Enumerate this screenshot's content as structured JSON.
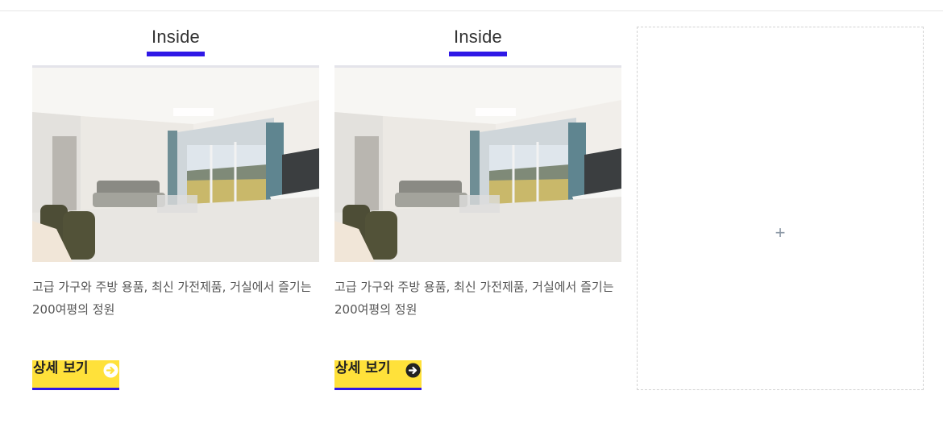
{
  "cards": [
    {
      "title": "Inside",
      "image_alt": "living room photo",
      "description": "고급 가구와 주방 용품,  최신 가전제품, 거실에서 즐기는 200여평의 정원",
      "detail_label": "상세 보기",
      "icon": "arrow-right-circle-icon",
      "icon_style": "light"
    },
    {
      "title": "Inside",
      "image_alt": "living room photo",
      "description": "고급 가구와 주방 용품,  최신 가전제품, 거실에서 즐기는 200여평의 정원",
      "detail_label": "상세 보기",
      "icon": "arrow-right-circle-icon",
      "icon_style": "dark"
    }
  ],
  "add_slot": {
    "symbol": "+"
  },
  "colors": {
    "accent_blue": "#2f18e6",
    "button_yellow": "#ffe13a",
    "plus_gray": "#8a97a4"
  }
}
